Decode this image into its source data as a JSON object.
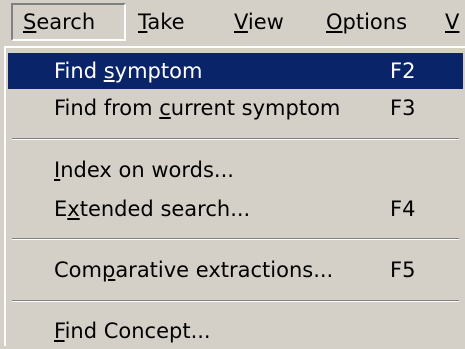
{
  "menubar": {
    "search": {
      "pre": "",
      "key": "S",
      "post": "earch"
    },
    "take": {
      "pre": "",
      "key": "T",
      "post": "ake"
    },
    "view": {
      "pre": "",
      "key": "V",
      "post": "iew"
    },
    "options": {
      "pre": "",
      "key": "O",
      "post": "ptions"
    },
    "w": {
      "pre": "",
      "key": "V",
      "post": ""
    }
  },
  "menu": {
    "items": [
      {
        "pre": "Find ",
        "key": "s",
        "post": "ymptom",
        "shortcut": "F2",
        "highlighted": true
      },
      {
        "pre": "Find from ",
        "key": "c",
        "post": "urrent symptom",
        "shortcut": "F3"
      },
      {
        "pre": "",
        "key": "I",
        "post": "ndex on words...",
        "shortcut": ""
      },
      {
        "pre": "E",
        "key": "x",
        "post": "tended search...",
        "shortcut": "F4"
      },
      {
        "pre": "Com",
        "key": "p",
        "post": "arative extractions...",
        "shortcut": "F5"
      },
      {
        "pre": "",
        "key": "F",
        "post": "ind Concept...",
        "shortcut": ""
      }
    ]
  },
  "colors": {
    "face": "#d4d0c8",
    "highlight": "#0a246a",
    "highlight_text": "#ffffff",
    "shadow": "#808080"
  }
}
